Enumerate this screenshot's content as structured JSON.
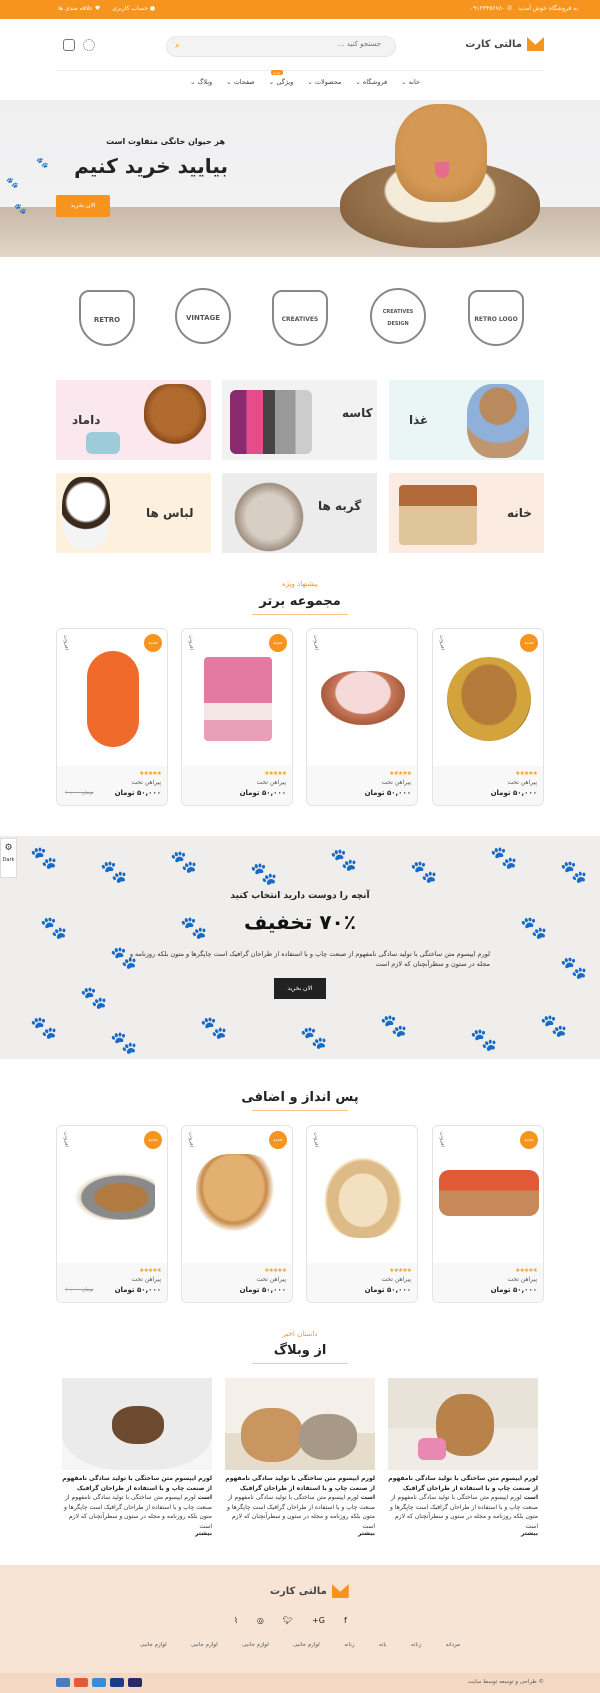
{
  "topbar": {
    "welcome": "به فروشگاه خوش آمدید",
    "phone": "۰۹۱۲۳۴۵۶۷۸۰",
    "account": "حساب کاربری",
    "wishlist": "علاقه مندی ها"
  },
  "header": {
    "logo_text": "مالتی کارت",
    "search_placeholder": "جستجو کنید ...",
    "nav": [
      "خانه",
      "فروشگاه",
      "محصولات",
      "ویژگی",
      "صفحات",
      "وبلاگ"
    ],
    "nav_badge": "جدید"
  },
  "hero": {
    "subtitle": "هر حیوان خانگی متفاوت است",
    "title": "بیایید خرید کنیم",
    "button": "الان بخرید"
  },
  "brand_logos": [
    "RETRO",
    "VINTAGE",
    "CREATIVES",
    "CREATIVES DESIGN",
    "RETRO LOGO"
  ],
  "categories": [
    "غذا",
    "کاسه",
    "داماد",
    "خانه",
    "گربه ها",
    "لباس ها"
  ],
  "featured": {
    "subtitle": "پیشنهاد ویژه",
    "title": "مجموعه برتر",
    "badge": "جدید",
    "wish": "افزودن",
    "stars": "★★★★★",
    "products": [
      {
        "name": "پیراهن تخت",
        "price": "۵۰,۰۰۰ تومان",
        "old": ""
      },
      {
        "name": "پیراهن تخت",
        "price": "۵۰,۰۰۰ تومان",
        "old": ""
      },
      {
        "name": "پیراهن تخت",
        "price": "۵۰,۰۰۰ تومان",
        "old": ""
      },
      {
        "name": "پیراهن تخت",
        "price": "۵۰,۰۰۰ تومان",
        "old": "۶۰,۰۰۰ تومان"
      }
    ]
  },
  "promo": {
    "line1": "آنچه را دوست دارید انتخاب کنید",
    "line2": "۷۰٪ تخفیف",
    "body": "لورم ایپسوم متن ساختگی با تولید سادگی نامفهوم از صنعت چاپ و با استفاده از طراحان گرافیک است چاپگرها و متون بلکه روزنامه و مجله در ستون و سطرآنچنان که لازم است",
    "button": "الان بخرید"
  },
  "side_widget": {
    "dark": "Dark"
  },
  "savings": {
    "title": "پس انداز و اضافی",
    "products": [
      {
        "name": "پیراهن تخت",
        "price": "۵۰,۰۰۰ تومان",
        "old": ""
      },
      {
        "name": "پیراهن تخت",
        "price": "۵۰,۰۰۰ تومان",
        "old": ""
      },
      {
        "name": "پیراهن تخت",
        "price": "۵۰,۰۰۰ تومان",
        "old": ""
      },
      {
        "name": "پیراهن تخت",
        "price": "۵۰,۰۰۰ تومان",
        "old": "۶۰,۰۰۰ تومان"
      }
    ]
  },
  "blog": {
    "subtitle": "داستان اخیر",
    "title": "از وبلاگ",
    "posts": [
      {
        "headline": "لورم ایپسوم متن ساختگی با تولید سادگی نامفهوم از صنعت چاپ و با استفاده از طراحان گرافیک است",
        "body": "لورم ایپسوم متن ساختگی با تولید سادگی نامفهوم از صنعت چاپ و با استفاده از طراحان گرافیک است چاپگرها و متون بلکه روزنامه و مجله در ستون و سطرآنچنان که لازم است",
        "more": "بیشتر"
      },
      {
        "headline": "لورم ایپسوم متن ساختگی با تولید سادگی نامفهوم از صنعت چاپ و با استفاده از طراحان گرافیک است",
        "body": "لورم ایپسوم متن ساختگی با تولید سادگی نامفهوم از صنعت چاپ و با استفاده از طراحان گرافیک است چاپگرها و متون بلکه روزنامه و مجله در ستون و سطرآنچنان که لازم است",
        "more": "بیشتر"
      },
      {
        "headline": "لورم ایپسوم متن ساختگی با تولید سادگی نامفهوم از صنعت چاپ و با استفاده از طراحان گرافیک است",
        "body": "لورم ایپسوم متن ساختگی با تولید سادگی نامفهوم از صنعت چاپ و با استفاده از طراحان گرافیک است چاپگرها و متون بلکه روزنامه و مجله در ستون و سطرآنچنان که لازم است",
        "more": "بیشتر"
      }
    ]
  },
  "footer": {
    "logo_text": "مالتی کارت",
    "links": [
      "مردانه",
      "زنانه",
      "بانه",
      "زنانه",
      "لوازم جانبی",
      "لوازم جانبی",
      "لوازم جانبی",
      "لوازم جانبی"
    ],
    "copyright": "© طراحی و توسعه توسط سایت"
  },
  "colors": {
    "accent": "#f7941d",
    "footer_bg": "#f8e4d4",
    "promo_bg": "#efeeec"
  }
}
